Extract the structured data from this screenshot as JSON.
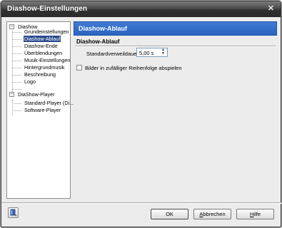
{
  "window": {
    "title": "Diashow-Einstellungen",
    "close_glyph": "✕"
  },
  "tree": {
    "nodes": [
      {
        "label": "Diashow",
        "level": 0,
        "expander": "−"
      },
      {
        "label": "Grundeinstellungen",
        "level": 1
      },
      {
        "label": "Diashow-Ablauf",
        "level": 1,
        "selected": true
      },
      {
        "label": "Diashow-Ende",
        "level": 1
      },
      {
        "label": "Überblendungen",
        "level": 1
      },
      {
        "label": "Musik-Einstellungen",
        "level": 1
      },
      {
        "label": "Hintergrundmusik",
        "level": 1
      },
      {
        "label": "Beschreibung",
        "level": 1
      },
      {
        "label": "Logo",
        "level": 1
      },
      {
        "label": "DiaShow-Player",
        "level": 0,
        "expander": "−"
      },
      {
        "label": "Standard-Player (Di...",
        "level": 1
      },
      {
        "label": "Software-Player",
        "level": 1
      }
    ]
  },
  "panel": {
    "header": "Diashow-Ablauf",
    "section_title": "Diashow-Ablauf",
    "duration_label": "Standardverweildauer:",
    "duration_value": "5,00 s",
    "random_order_label": "Bilder in zufälliger Reihenfolge abspielen",
    "random_order_checked": false
  },
  "footer": {
    "ok_label": "OK",
    "cancel_label_u": "A",
    "cancel_label_rest": "bbrechen",
    "help_label_u": "H",
    "help_label_rest": "ilfe"
  },
  "colors": {
    "accent": "#2b63c0",
    "selection": "#2b4a8e",
    "titlebar": "#2a2a2a"
  },
  "icons": {
    "help_button": "help-book-icon",
    "spin_up": "triangle-up",
    "spin_down": "triangle-down"
  }
}
